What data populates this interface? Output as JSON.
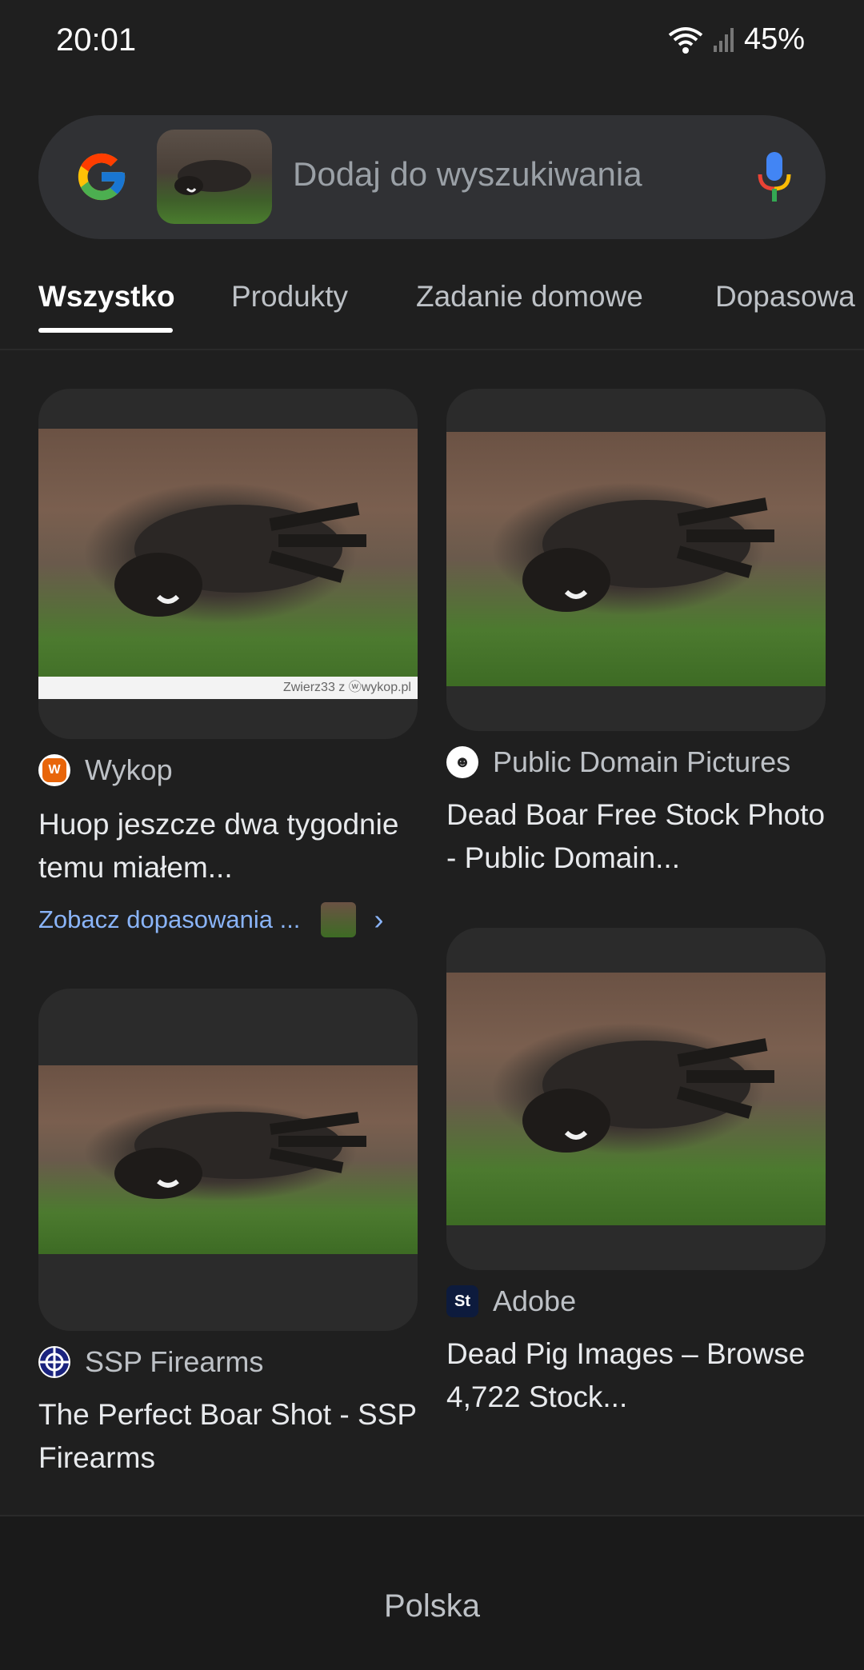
{
  "status_bar": {
    "time": "20:01",
    "battery": "45%",
    "icons": [
      "wifi-icon",
      "signal-icon"
    ]
  },
  "search": {
    "placeholder": "Dodaj do wyszukiwania",
    "logo": "google-logo-icon",
    "mic": "mic-icon"
  },
  "tabs": [
    {
      "label": "Wszystko",
      "active": true
    },
    {
      "label": "Produkty",
      "active": false
    },
    {
      "label": "Zadanie domowe",
      "active": false
    },
    {
      "label": "Dopasowa",
      "active": false
    }
  ],
  "results": [
    {
      "source": "Wykop",
      "title": "Huop jeszcze dwa tygodnie temu miałem...",
      "watermark": "Zwierz33 z ⓦwykop.pl",
      "see_matches": "Zobacz dopasowania ..."
    },
    {
      "source": "Public Domain Pictures",
      "title": "Dead Boar Free Stock Photo - Public Domain..."
    },
    {
      "source": "SSP Firearms",
      "title": "The Perfect Boar Shot - SSP Firearms"
    },
    {
      "source": "Adobe",
      "title": "Dead Pig Images – Browse 4,722 Stock...",
      "favicon_text": "St"
    }
  ],
  "footer": {
    "country": "Polska"
  },
  "colors": {
    "background": "#1f1f1f",
    "search_bg": "#303134",
    "link": "#8ab4f8"
  }
}
